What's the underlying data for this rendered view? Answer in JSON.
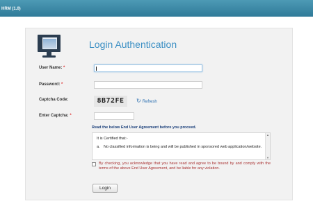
{
  "app": {
    "title": "HRM (1.0)"
  },
  "login": {
    "heading": "Login Authentication",
    "username_label": "User Name:",
    "password_label": "Password:",
    "captcha_label": "Captcha Code:",
    "enter_captcha_label": "Enter Captcha:",
    "required_mark": "*",
    "username_value": "",
    "password_value": "",
    "captcha_value": "",
    "captcha_code": "8B72FE",
    "refresh_label": "Refresh",
    "agreement_heading": "Read the below End User Agreement before you proceed.",
    "agreement_intro": "It is Certified that:-",
    "agreement_item_marker": "a.",
    "agreement_item_text": "No classified information is being and will be published in sponsored web application/website.",
    "checkbox_text": "By checking, you acknowledge that you have read and agree to be bound by and comply with the terms of the above End User Agreement, and be liable for any violation.",
    "checkbox_checked": false,
    "login_button": "Login"
  },
  "colors": {
    "topbar": "#2f7a98",
    "heading": "#3b8fc4",
    "required": "#dd3333",
    "agreement_heading": "#1a3f7a",
    "checkbox_text": "#aa3333"
  },
  "icons": {
    "logo": "monitor-icon",
    "refresh": "refresh-icon"
  }
}
